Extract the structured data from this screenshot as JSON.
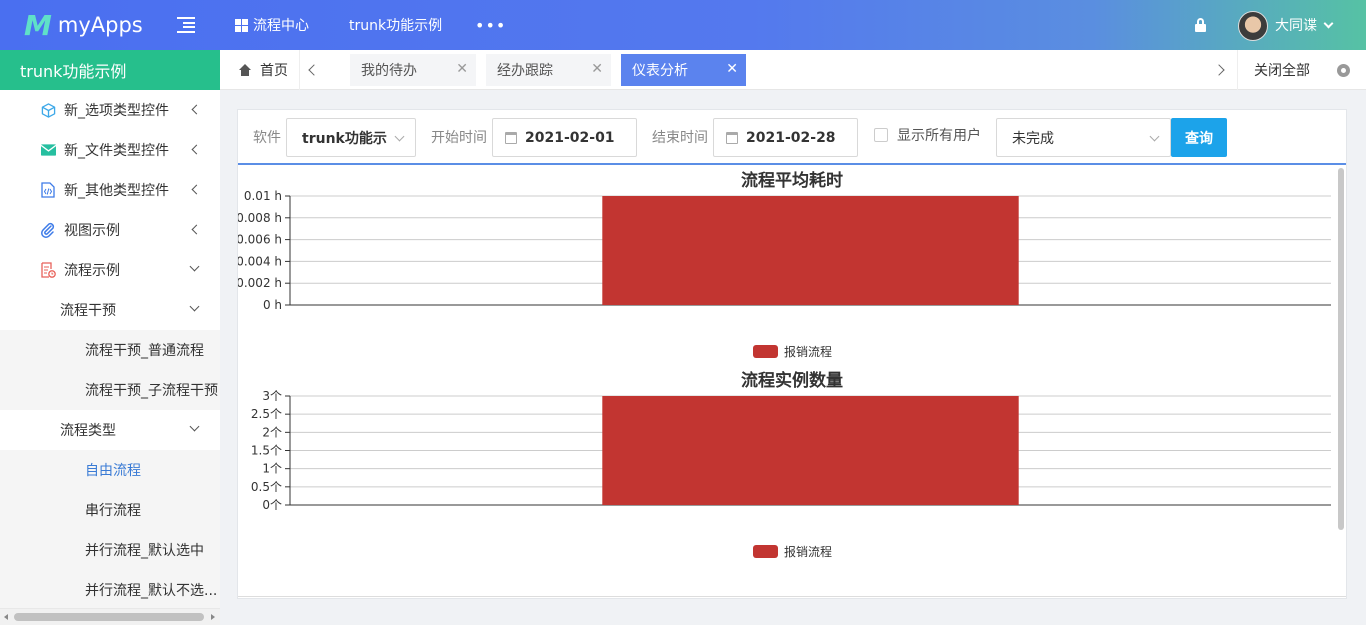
{
  "header": {
    "logo_mark": "M",
    "logo_text": "myApps",
    "nav": [
      {
        "label": "流程中心"
      },
      {
        "label": "trunk功能示例"
      },
      {
        "label": "•••"
      }
    ],
    "username": "大同谍",
    "brand_color": "#4a6ff0"
  },
  "sidebar": {
    "title": "trunk功能示例",
    "items": [
      {
        "label": "新_选项类型控件",
        "icon": "cube-icon"
      },
      {
        "label": "新_文件类型控件",
        "icon": "mail-icon"
      },
      {
        "label": "新_其他类型控件",
        "icon": "code-file-icon"
      },
      {
        "label": "视图示例",
        "icon": "paperclip-icon"
      },
      {
        "label": "流程示例",
        "icon": "flow-doc-icon"
      },
      {
        "label": "流程干预"
      },
      {
        "label": "流程干预_普通流程"
      },
      {
        "label": "流程干预_子流程干预"
      },
      {
        "label": "流程类型"
      },
      {
        "label": "自由流程"
      },
      {
        "label": "串行流程"
      },
      {
        "label": "并行流程_默认选中"
      },
      {
        "label": "并行流程_默认不选..."
      }
    ]
  },
  "tabs": {
    "home": "首页",
    "items": [
      {
        "label": "我的待办"
      },
      {
        "label": "经办跟踪"
      },
      {
        "label": "仪表分析"
      }
    ],
    "close_all": "关闭全部"
  },
  "filters": {
    "software_label": "软件",
    "software_value": "trunk功能示例",
    "start_label": "开始时间",
    "start_value": "2021-02-01",
    "end_label": "结束时间",
    "end_value": "2021-02-28",
    "show_all_users": "显示所有用户",
    "status_value": "未完成",
    "query_button": "查询"
  },
  "chart_data": [
    {
      "type": "bar",
      "title": "流程平均耗时",
      "categories": [
        ""
      ],
      "series": [
        {
          "name": "报销流程",
          "values": [
            0.01
          ],
          "color": "#c23531"
        }
      ],
      "yticks": [
        "0 h",
        "0.002 h",
        "0.004 h",
        "0.006 h",
        "0.008 h",
        "0.01 h"
      ],
      "ylim": [
        0,
        0.01
      ],
      "grid": true,
      "legend": "bottom-center"
    },
    {
      "type": "bar",
      "title": "流程实例数量",
      "categories": [
        ""
      ],
      "series": [
        {
          "name": "报销流程",
          "values": [
            3
          ],
          "color": "#c23531"
        }
      ],
      "yticks": [
        "0个",
        "0.5个",
        "1个",
        "1.5个",
        "2个",
        "2.5个",
        "3个"
      ],
      "ylim": [
        0,
        3
      ],
      "grid": true,
      "legend": "bottom-center"
    }
  ]
}
